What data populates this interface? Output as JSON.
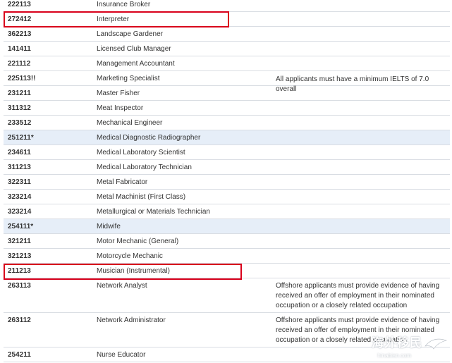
{
  "rows": [
    {
      "code": "222113",
      "occupation": "Insurance Broker",
      "note": ""
    },
    {
      "code": "272412",
      "occupation": "Interpreter",
      "note": ""
    },
    {
      "code": "362213",
      "occupation": "Landscape Gardener",
      "note": ""
    },
    {
      "code": "141411",
      "occupation": "Licensed Club Manager",
      "note": ""
    },
    {
      "code": "221112",
      "occupation": "Management Accountant",
      "note": ""
    },
    {
      "code": "225113!!",
      "occupation": "Marketing Specialist",
      "note": "All applicants must have a minimum IELTS of 7.0 overall"
    },
    {
      "code": "231211",
      "occupation": "Master Fisher",
      "note": ""
    },
    {
      "code": "311312",
      "occupation": "Meat Inspector",
      "note": ""
    },
    {
      "code": "233512",
      "occupation": "Mechanical Engineer",
      "note": ""
    },
    {
      "code": "251211*",
      "occupation": "Medical Diagnostic Radiographer",
      "note": ""
    },
    {
      "code": "234611",
      "occupation": "Medical Laboratory Scientist",
      "note": ""
    },
    {
      "code": "311213",
      "occupation": "Medical Laboratory Technician",
      "note": ""
    },
    {
      "code": "322311",
      "occupation": "Metal Fabricator",
      "note": ""
    },
    {
      "code": "323214",
      "occupation": "Metal Machinist (First Class)",
      "note": ""
    },
    {
      "code": "323214",
      "occupation": "Metallurgical or Materials Technician",
      "note": ""
    },
    {
      "code": "254111*",
      "occupation": "Midwife",
      "note": ""
    },
    {
      "code": "321211",
      "occupation": "Motor Mechanic (General)",
      "note": ""
    },
    {
      "code": "321213",
      "occupation": "Motorcycle Mechanic",
      "note": ""
    },
    {
      "code": "211213",
      "occupation": "Musician (Instrumental)",
      "note": ""
    },
    {
      "code": "263113",
      "occupation": "Network Analyst",
      "note": "Offshore applicants must provide evidence of having received an offer of employment in their nominated occupation or a closely related occupation"
    },
    {
      "code": "263112",
      "occupation": "Network Administrator",
      "note": "Offshore applicants must  provide evidence of having received an offer of employment in their nominated occupation or a closely related occupation"
    },
    {
      "code": "254211",
      "occupation": "Nurse Educator",
      "note": ""
    }
  ],
  "watermark": {
    "main": "海外移民",
    "sub": "hinabian.com"
  },
  "colors": {
    "highlight_row": "#e6eef8",
    "annotation_box": "#d9001b"
  }
}
